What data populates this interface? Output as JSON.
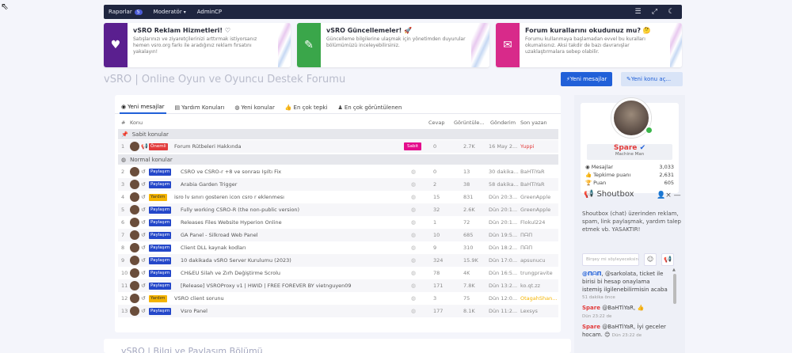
{
  "nav": {
    "items": [
      {
        "label": "Raporlar",
        "badge": "5"
      },
      {
        "label": "Moderatör"
      },
      {
        "label": "AdminCP"
      }
    ],
    "tools": [
      "sliders-icon",
      "expand-icon",
      "moon-icon"
    ]
  },
  "notices": [
    {
      "title": "vSRO Reklam Hizmetleri! ♡",
      "text": "Satışlarınızı ve ziyaretçilerinizi arttırmak istiyorsanız hemen vsro.org farkı ile aradığınız reklam fırsatını yakalayın!",
      "color": "#5a1f8f"
    },
    {
      "title": "vSRO Güncellemeler! 🚀",
      "text": "Güncelleme bilgilerine ulaşmak için yönetimden duyurular bölümümüzü inceleyebilirsiniz.",
      "color": "#3aa64a"
    },
    {
      "title": "Forum kurallarını okudunuz mu? 🤔",
      "text": "Forumu kullanmaya başlamadan evvel bu kuralları okumalısınız. Aksi takdir de bazı davranışlar uzaklaştırmalara sebep olabilir.",
      "color": "#d82a8a"
    }
  ],
  "page": {
    "title": "vSRO | Online Oyun ve Oyuncu Destek Forumu",
    "btn_new_posts": "Yeni mesajlar",
    "btn_new_thread": "Yeni konu aç..."
  },
  "tabs": [
    "Yeni mesajlar",
    "Yardım Konuları",
    "Yeni konular",
    "En çok tepki",
    "En çok görüntülenen"
  ],
  "table": {
    "headers": {
      "hash": "#",
      "topic": "Konu",
      "replies": "Cevap",
      "views": "Görüntüle...",
      "sent": "Gönderim",
      "last": "Son yazan"
    },
    "sticky_title": "Sabit konular",
    "normal_title": "Normal konular",
    "sticky_label": "Sabit",
    "sticky_rows": [
      {
        "n": "1",
        "prefix": "Önemli",
        "prefix_color": "#e23b3b",
        "title": "Forum Rütbeleri Hakkında",
        "replies": "0",
        "views": "2.7K",
        "sent": "16 May 2...",
        "last": "Yuppi",
        "last_color": "#e23b3b"
      }
    ],
    "rows": [
      {
        "n": "2",
        "prefix": "Paylaşım",
        "prefix_color": "#2447c9",
        "title": "CSRO ve CSRO-r +8 ve sonrası Işıltı Fix",
        "replies": "0",
        "views": "13",
        "sent": "30 dakika...",
        "last": "BaHTiYaR"
      },
      {
        "n": "3",
        "prefix": "Paylaşım",
        "prefix_color": "#2447c9",
        "title": "Arabia Garden Trigger",
        "replies": "2",
        "views": "38",
        "sent": "58 dakika...",
        "last": "BaHTiYaR"
      },
      {
        "n": "4",
        "prefix": "Yardım",
        "prefix_color": "#f5b400",
        "title": "isro lv sınırı gosteren icon csro r eklenmesı",
        "replies": "15",
        "views": "831",
        "sent": "Dün 20:3...",
        "last": "GreenApple"
      },
      {
        "n": "5",
        "prefix": "Paylaşım",
        "prefix_color": "#2447c9",
        "title": "Fully working CSRO-R (the non-public version)",
        "replies": "32",
        "views": "2.6K",
        "sent": "Dün 20:1...",
        "last": "GreenApple"
      },
      {
        "n": "6",
        "prefix": "Paylaşım",
        "prefix_color": "#2447c9",
        "title": "Releases Files Website Hyperion Online",
        "replies": "1",
        "views": "72",
        "sent": "Dün 20:1...",
        "last": "Flokul224"
      },
      {
        "n": "7",
        "prefix": "Paylaşım",
        "prefix_color": "#2447c9",
        "title": "GA Panel - Silkroad Web Panel",
        "replies": "10",
        "views": "685",
        "sent": "Dün 19:5...",
        "last": "ΠᗩΠ"
      },
      {
        "n": "8",
        "prefix": "Paylaşım",
        "prefix_color": "#2447c9",
        "title": "Client DLL kaynak kodları",
        "replies": "9",
        "views": "310",
        "sent": "Dün 18:2...",
        "last": "ΠᗩΠ"
      },
      {
        "n": "9",
        "prefix": "Paylaşım",
        "prefix_color": "#2447c9",
        "title": "10 dakikada vSRO Server Kurulumu (2023)",
        "replies": "324",
        "views": "15.9K",
        "sent": "Dün 17:0...",
        "last": "apsunucu"
      },
      {
        "n": "10",
        "prefix": "Paylaşım",
        "prefix_color": "#2447c9",
        "title": "CH&EU Silah ve Zırh Değiştirme Scrolu",
        "replies": "78",
        "views": "4K",
        "sent": "Dün 16:5...",
        "last": "trungpravite"
      },
      {
        "n": "11",
        "prefix": "Paylaşım",
        "prefix_color": "#2447c9",
        "title": "[Release] VSROProxy v1 | HWID | FREE FOREVER BY vietnguyen09",
        "replies": "171",
        "views": "7.8K",
        "sent": "Dün 13:2...",
        "last": "ko.qt.zz"
      },
      {
        "n": "12",
        "prefix": "Yardım",
        "prefix_color": "#f5b400",
        "title": "VSRO client sorunu",
        "replies": "3",
        "views": "75",
        "sent": "Dün 12:0...",
        "last": "OtagahShan...",
        "last_color": "#f5b400"
      },
      {
        "n": "13",
        "prefix": "Paylaşım",
        "prefix_color": "#2447c9",
        "title": "Vsro Panel",
        "replies": "177",
        "views": "8.1K",
        "sent": "Dün 11:2...",
        "last": "Lexsys"
      }
    ]
  },
  "profile": {
    "name": "Spare",
    "title": "Machine Man",
    "stats": [
      {
        "label": "Mesajlar",
        "value": "3,033"
      },
      {
        "label": "Tepkime puanı",
        "value": "2,631"
      },
      {
        "label": "Puan",
        "value": "605"
      }
    ]
  },
  "shoutbox": {
    "title": "Shoutbox",
    "desc": "Shoutbox (chat) üzerinden reklam, spam, link paylaşmak, yardım talep etmek vb. YASAKTIR!",
    "placeholder": "Birşey mi söyleyeceksin",
    "messages": [
      {
        "name": "@ΠᗩΠ",
        "text": "@sarkolata, ticket ile birisi bi hesap onaylama istemiş ilgilenebilirmisin acaba",
        "time": "51 dakika önce",
        "red": false
      },
      {
        "name": "Spare",
        "text": "@BaHTiYaR, 👍",
        "time": "Dün 23:22 de",
        "red": true
      },
      {
        "name": "Spare",
        "text": "@BaHTiYaR, İyi geceler hocam. 😊",
        "time": "Dün 23:22 de",
        "red": true
      }
    ]
  },
  "bottom_section": "vSRO | Bilgi ve Paylaşım Bölümü"
}
